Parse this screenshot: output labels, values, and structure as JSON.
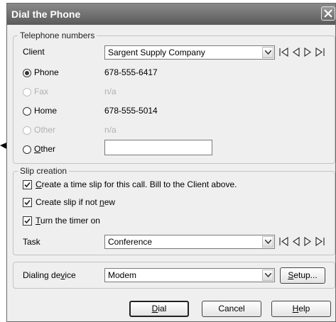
{
  "dialog": {
    "title": "Dial the Phone"
  },
  "telephone_numbers": {
    "legend": "Telephone numbers",
    "client_label": "Client",
    "client_value": "Sargent Supply Company",
    "rows": [
      {
        "label": "Phone",
        "value": "678-555-6417",
        "selected": true,
        "enabled": true
      },
      {
        "label": "Fax",
        "value": "n/a",
        "selected": false,
        "enabled": false
      },
      {
        "label": "Home",
        "value": "678-555-5014",
        "selected": false,
        "enabled": true
      },
      {
        "label": "Other",
        "value": "n/a",
        "selected": false,
        "enabled": false
      }
    ],
    "other_label_first": "O",
    "other_label_rest": "ther",
    "other_value": ""
  },
  "slip_creation": {
    "legend": "Slip creation",
    "create_time_slip_first": "C",
    "create_time_slip_rest": "reate a time slip for this call. Bill to the Client above.",
    "create_if_not_new_pre": "Create slip if not ",
    "create_if_not_new_u": "n",
    "create_if_not_new_post": "ew",
    "timer_first": "T",
    "timer_rest": "urn the timer on",
    "task_label": "Task",
    "task_value": "Conference"
  },
  "dialing": {
    "label_pre": "Dialing de",
    "label_u": "v",
    "label_post": "ice",
    "device_value": "Modem",
    "setup_u": "S",
    "setup_rest": "etup..."
  },
  "buttons": {
    "dial_u": "D",
    "dial_rest": "ial",
    "cancel": "Cancel",
    "help_u": "H",
    "help_rest": "elp"
  },
  "nav_icons": [
    "first-record-icon",
    "previous-record-icon",
    "next-record-icon",
    "last-record-icon"
  ]
}
